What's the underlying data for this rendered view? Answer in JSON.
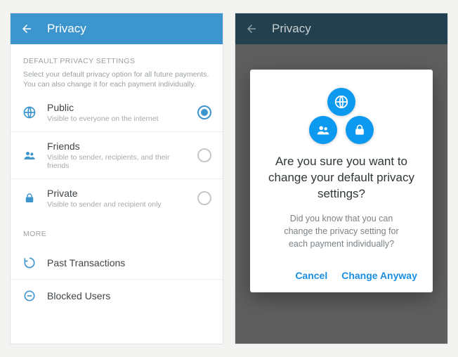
{
  "colors": {
    "accent": "#3D95CE",
    "dialogAccent": "#0c99f0"
  },
  "left": {
    "title": "Privacy",
    "defaultSection": {
      "heading": "DEFAULT PRIVACY SETTINGS",
      "description": "Select your default privacy option for all future payments. You can also change it for each payment individually."
    },
    "options": [
      {
        "key": "public",
        "label": "Public",
        "support": "Visible to everyone on the internet",
        "selected": true
      },
      {
        "key": "friends",
        "label": "Friends",
        "support": "Visible to sender, recipients, and their friends",
        "selected": false
      },
      {
        "key": "private",
        "label": "Private",
        "support": "Visible to sender and recipient only",
        "selected": false
      }
    ],
    "moreSection": {
      "heading": "MORE"
    },
    "moreItems": [
      {
        "key": "past-transactions",
        "label": "Past Transactions"
      },
      {
        "key": "blocked-users",
        "label": "Blocked Users"
      }
    ]
  },
  "right": {
    "title": "Privacy",
    "dialog": {
      "heading": "Are you sure you want to change your default privacy settings?",
      "body": "Did you know that you can change the privacy setting for each payment individually?",
      "cancel": "Cancel",
      "confirm": "Change Anyway"
    }
  }
}
